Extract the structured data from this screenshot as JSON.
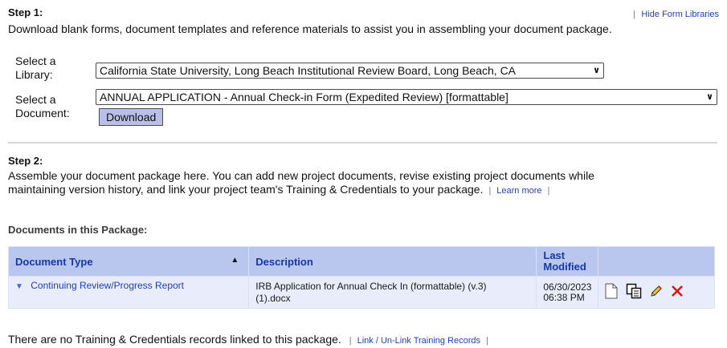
{
  "step1": {
    "heading": "Step 1:",
    "hide_link": "Hide Form Libraries",
    "description": "Download blank forms, document templates and reference materials to assist you in assembling your document package.",
    "library_label_line1": "Select a",
    "library_label_line2": "Library:",
    "library_value": "California State University, Long Beach Institutional Review Board, Long Beach, CA",
    "document_label_line1": "Select a",
    "document_label_line2": "Document:",
    "document_value": "ANNUAL APPLICATION - Annual Check-in Form (Expedited Review) [formattable]",
    "download_label": "Download"
  },
  "step2": {
    "heading": "Step 2:",
    "description_line1": "Assemble your document package here. You can add new project documents, revise existing project documents while",
    "description_line2": "maintaining version history, and link your project team's Training & Credentials to your package.",
    "learn_more": "Learn more"
  },
  "documents": {
    "heading": "Documents in this Package:",
    "columns": {
      "type": "Document Type",
      "description": "Description",
      "modified_line1": "Last",
      "modified_line2": "Modified"
    },
    "rows": [
      {
        "type": "Continuing Review/Progress Report",
        "description_line1": "IRB Application for Annual Check In (formattable) (v.3)",
        "description_line2": "(1).docx",
        "date": "06/30/2023",
        "time": "06:38 PM"
      }
    ]
  },
  "training": {
    "message": "There are no Training & Credentials records linked to this package.",
    "link_label": "Link / Un-Link Training Records"
  },
  "icons": {
    "row_actions": [
      "document-icon",
      "copy-icon",
      "pencil-icon",
      "delete-icon"
    ],
    "delete_color": "#e01010"
  }
}
